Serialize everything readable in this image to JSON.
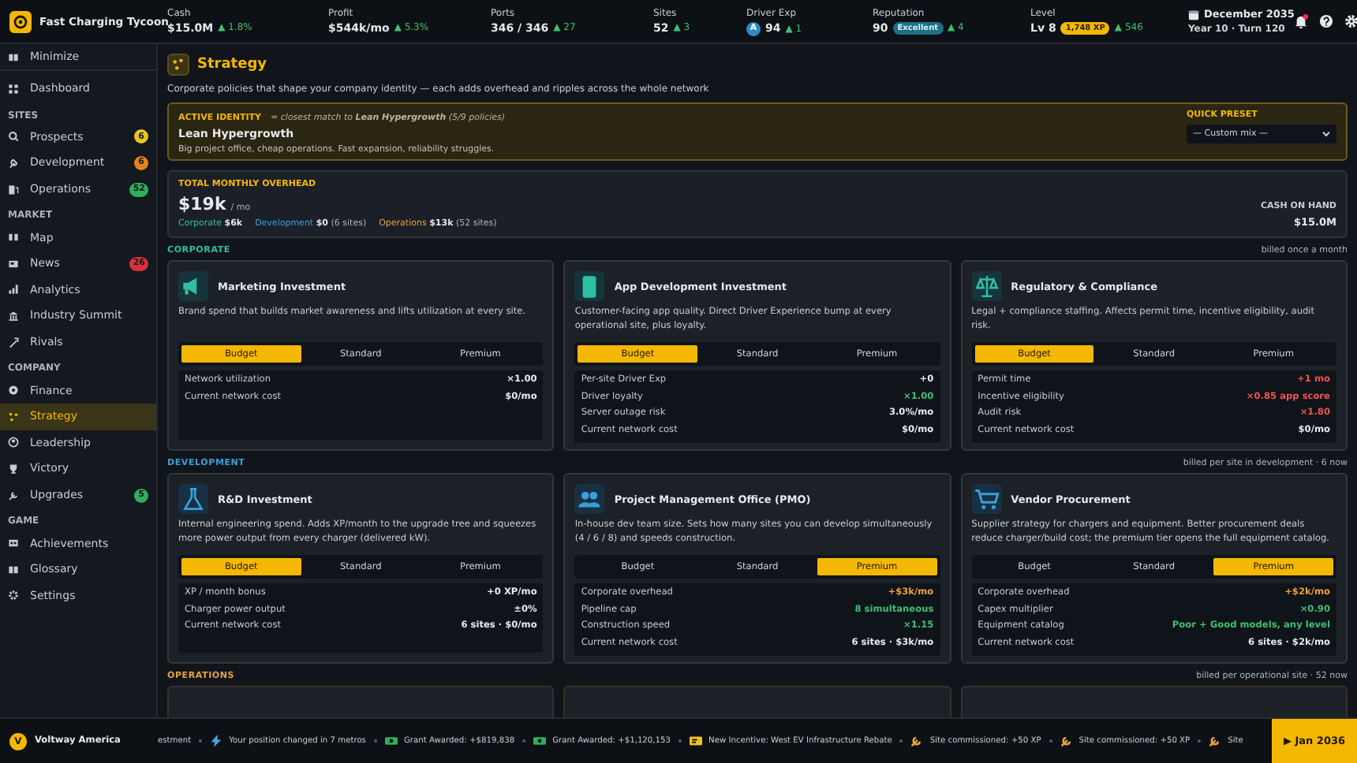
{
  "top_bar": {
    "app_title": "Fast Charging Tycoon",
    "stats": [
      {
        "kind": "plain",
        "label": "Cash",
        "value": "$15.0M",
        "delta": "▲ 1.8%"
      },
      {
        "kind": "plain",
        "label": "Profit",
        "value": "$544k/mo",
        "delta": "▲ 5.3%"
      },
      {
        "kind": "plain",
        "label": "Ports",
        "value": "346 / 346",
        "delta": "▲ 27"
      },
      {
        "kind": "plain",
        "label": "Sites",
        "value": "52",
        "delta": "▲ 3"
      },
      {
        "kind": "grade",
        "label": "Driver Exp",
        "badge": "A",
        "value": "94",
        "delta": "▲ 1"
      },
      {
        "kind": "rating",
        "label": "Reputation",
        "value": "90",
        "badge": "Excellent",
        "delta": "▲ 4"
      },
      {
        "kind": "level",
        "label": "Level",
        "value": "Lv 8",
        "badge": "1,748 XP",
        "delta": "▲ 546"
      }
    ],
    "date": "December 2035",
    "turn": "Year 10 · Turn 120",
    "unread_notifications": true
  },
  "sidebar": {
    "minimize": "Minimize",
    "groups": [
      {
        "items": [
          {
            "label": "Dashboard",
            "selected": false
          }
        ]
      },
      {
        "heading": "SITES",
        "items": [
          {
            "label": "Prospects",
            "badge": "6",
            "color": "#e8c420",
            "selected": false
          },
          {
            "label": "Development",
            "badge": "6",
            "color": "#e8821e",
            "selected": false
          },
          {
            "label": "Operations",
            "badge": "52",
            "color": "#2fae5c",
            "selected": false
          }
        ]
      },
      {
        "heading": "MARKET",
        "items": [
          {
            "label": "Map",
            "selected": false
          },
          {
            "label": "News",
            "badge": "26",
            "color": "#d8323c",
            "selected": false
          },
          {
            "label": "Analytics",
            "selected": false
          },
          {
            "label": "Industry Summit",
            "selected": false
          },
          {
            "label": "Rivals",
            "selected": false
          }
        ]
      },
      {
        "heading": "COMPANY",
        "items": [
          {
            "label": "Finance",
            "selected": false
          },
          {
            "label": "Strategy",
            "selected": true
          },
          {
            "label": "Leadership",
            "selected": false
          },
          {
            "label": "Victory",
            "selected": false
          },
          {
            "label": "Upgrades",
            "badge": "5",
            "color": "#2fae5c",
            "selected": false
          }
        ]
      },
      {
        "heading": "GAME",
        "items": [
          {
            "label": "Achievements",
            "selected": false
          },
          {
            "label": "Glossary",
            "selected": false
          },
          {
            "label": "Settings",
            "selected": false
          }
        ]
      }
    ]
  },
  "page": {
    "title": "Strategy",
    "subtitle": "Corporate policies that shape your company identity — each adds overhead and ripples across the whole network",
    "identity": {
      "label": "ACTIVE IDENTITY",
      "match": "= closest match to **Lean Hypergrowth** (5/9 policies)",
      "name": "Lean Hypergrowth",
      "description": "Big project office, cheap operations. Fast expansion, reliability struggles.",
      "preset_label": "QUICK PRESET",
      "preset_value": "— Custom mix —"
    },
    "overhead": {
      "label": "TOTAL MONTHLY OVERHEAD",
      "value": "$19k",
      "unit": "/ mo",
      "breakdown": [
        {
          "name": "Corporate",
          "color": "#2fbfa4",
          "amount": "$6k"
        },
        {
          "name": "Development",
          "color": "#3b9fd6",
          "amount": "$0",
          "note": "(6 sites)"
        },
        {
          "name": "Operations",
          "color": "#e8a33a",
          "amount": "$13k",
          "note": "(52 sites)"
        }
      ],
      "cash_label": "CASH ON HAND",
      "cash_value": "$15.0M"
    },
    "sections": [
      {
        "title": "CORPORATE",
        "color": "#2fbfa4",
        "note": "billed once a month",
        "policies": [
          {
            "title": "Marketing Investment",
            "description": "Brand spend that builds market awareness and lifts utilization at every site.",
            "options": [
              {
                "label": "Budget",
                "selected": true
              },
              {
                "label": "Standard",
                "selected": false
              },
              {
                "label": "Premium",
                "selected": false
              }
            ],
            "effects": [
              {
                "label": "Network utilization",
                "value": "×1.00",
                "kind": "neutral"
              },
              {
                "label": "Current network cost",
                "value": "$0/mo",
                "kind": "neutral"
              }
            ]
          },
          {
            "title": "App Development Investment",
            "description": "Customer-facing app quality. Direct Driver Experience bump at every operational site, plus loyalty.",
            "options": [
              {
                "label": "Budget",
                "selected": true
              },
              {
                "label": "Standard",
                "selected": false
              },
              {
                "label": "Premium",
                "selected": false
              }
            ],
            "effects": [
              {
                "label": "Per-site Driver Exp",
                "value": "+0",
                "kind": "neutral"
              },
              {
                "label": "Driver loyalty",
                "value": "×1.00",
                "kind": "good"
              },
              {
                "label": "Server outage risk",
                "value": "3.0%/mo",
                "kind": "neutral"
              },
              {
                "label": "Current network cost",
                "value": "$0/mo",
                "kind": "neutral"
              }
            ]
          },
          {
            "title": "Regulatory & Compliance",
            "description": "Legal + compliance staffing. Affects permit time, incentive eligibility, audit risk.",
            "options": [
              {
                "label": "Budget",
                "selected": true
              },
              {
                "label": "Standard",
                "selected": false
              },
              {
                "label": "Premium",
                "selected": false
              }
            ],
            "effects": [
              {
                "label": "Permit time",
                "value": "+1 mo",
                "kind": "bad"
              },
              {
                "label": "Incentive eligibility",
                "value": "×0.85 app score",
                "kind": "bad"
              },
              {
                "label": "Audit risk",
                "value": "×1.80",
                "kind": "bad"
              },
              {
                "label": "Current network cost",
                "value": "$0/mo",
                "kind": "neutral"
              }
            ]
          }
        ]
      },
      {
        "title": "DEVELOPMENT",
        "color": "#3b9fd6",
        "note": "billed per site in development · 6 now",
        "policies": [
          {
            "title": "R&D Investment",
            "description": "Internal engineering spend. Adds XP/month to the upgrade tree and squeezes more power output from every charger (delivered kW).",
            "options": [
              {
                "label": "Budget",
                "selected": true
              },
              {
                "label": "Standard",
                "selected": false
              },
              {
                "label": "Premium",
                "selected": false
              }
            ],
            "effects": [
              {
                "label": "XP / month bonus",
                "value": "+0 XP/mo",
                "kind": "neutral"
              },
              {
                "label": "Charger power output",
                "value": "±0%",
                "kind": "neutral"
              },
              {
                "label": "Current network cost",
                "value": "6 sites · $0/mo",
                "kind": "neutral"
              }
            ]
          },
          {
            "title": "Project Management Office (PMO)",
            "description": "In-house dev team size. Sets how many sites you can develop simultaneously (4 / 6 / 8) and speeds construction.",
            "options": [
              {
                "label": "Budget",
                "selected": false
              },
              {
                "label": "Standard",
                "selected": false
              },
              {
                "label": "Premium",
                "selected": true
              }
            ],
            "effects": [
              {
                "label": "Corporate overhead",
                "value": "+$3k/mo",
                "kind": "cost"
              },
              {
                "label": "Pipeline cap",
                "value": "8 simultaneous",
                "kind": "good"
              },
              {
                "label": "Construction speed",
                "value": "×1.15",
                "kind": "good"
              },
              {
                "label": "Current network cost",
                "value": "6 sites · $3k/mo",
                "kind": "neutral"
              }
            ]
          },
          {
            "title": "Vendor Procurement",
            "description": "Supplier strategy for chargers and equipment. Better procurement deals reduce charger/build cost; the premium tier opens the full equipment catalog.",
            "options": [
              {
                "label": "Budget",
                "selected": false
              },
              {
                "label": "Standard",
                "selected": false
              },
              {
                "label": "Premium",
                "selected": true
              }
            ],
            "effects": [
              {
                "label": "Corporate overhead",
                "value": "+$2k/mo",
                "kind": "cost"
              },
              {
                "label": "Capex multiplier",
                "value": "×0.90",
                "kind": "good"
              },
              {
                "label": "Equipment catalog",
                "value": "Poor + Good models, any level",
                "kind": "good"
              },
              {
                "label": "Current network cost",
                "value": "6 sites · $2k/mo",
                "kind": "neutral"
              }
            ]
          }
        ]
      },
      {
        "title": "OPERATIONS",
        "color": "#e8a33a",
        "note": "billed per operational site · 52 now"
      }
    ]
  },
  "bottom_bar": {
    "company": "Voltway America",
    "avatar": "V",
    "ticker": [
      {
        "kind": "cut",
        "text": "estment"
      },
      {
        "kind": "position",
        "text": "Your position changed in 7 metros"
      },
      {
        "kind": "grant",
        "text": "Grant Awarded: +$819,838"
      },
      {
        "kind": "grant",
        "text": "Grant Awarded: +$1,120,153"
      },
      {
        "kind": "incentive",
        "text": "New Incentive: West EV Infrastructure Rebate"
      },
      {
        "kind": "site",
        "text": "Site commissioned: +50 XP"
      },
      {
        "kind": "site",
        "text": "Site commissioned: +50 XP"
      },
      {
        "kind": "site",
        "text": "Site"
      }
    ],
    "next_button": "▶ Jan 2036"
  }
}
